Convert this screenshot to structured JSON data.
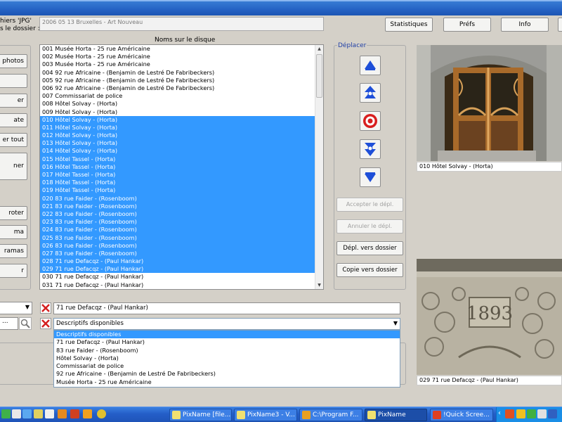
{
  "header": {
    "files_label_line1": "hiers 'JPG'",
    "files_label_line2": "s le dossier :",
    "folder_name": "2006 05 13 Bruxelles - Art Nouveau",
    "buttons": {
      "stats": "Statistiques",
      "prefs": "Préfs",
      "info": "Info"
    }
  },
  "left_buttons": [
    "photos",
    "",
    "er",
    "ate",
    "er tout",
    "ner",
    "roter",
    "ma",
    "ramas",
    "r"
  ],
  "file_list": {
    "title": "Noms sur le disque",
    "items": [
      "001  Musée Horta - 25 rue Américaine",
      "002  Musée Horta - 25 rue Américaine",
      "003  Musée Horta - 25 rue Américaine",
      "004  92 rue Africaine - (Benjamin de Lestré De Fabribeckers)",
      "005  92 rue Africaine - (Benjamin de Lestré De Fabribeckers)",
      "006  92 rue Africaine - (Benjamin de Lestré De Fabribeckers)",
      "007  Commissariat de police",
      "008  Hôtel Solvay - (Horta)",
      "009  Hôtel Solvay - (Horta)",
      "010  Hôtel Solvay - (Horta)",
      "011  Hôtel Solvay - (Horta)",
      "012  Hôtel Solvay - (Horta)",
      "013  Hôtel Solvay - (Horta)",
      "014  Hôtel Solvay - (Horta)",
      "015  Hôtel Tassel - (Horta)",
      "016  Hôtel Tassel - (Horta)",
      "017  Hôtel Tassel - (Horta)",
      "018  Hôtel Tassel - (Horta)",
      "019  Hôtel Tassel - (Horta)",
      "020  83 rue Faider - (Rosenboom)",
      "021  83 rue Faider - (Rosenboom)",
      "022  83 rue Faider - (Rosenboom)",
      "023  83 rue Faider - (Rosenboom)",
      "024  83 rue Faider - (Rosenboom)",
      "025  83 rue Faider - (Rosenboom)",
      "026  83 rue Faider - (Rosenboom)",
      "027  83 rue Faider - (Rosenboom)",
      "028  71 rue Defacqz - (Paul Hankar)",
      "029  71 rue Defacqz - (Paul Hankar)",
      "030  71 rue Defacqz - (Paul Hankar)",
      "031  71 rue Defacqz - (Paul Hankar)"
    ],
    "selected_from": 9,
    "selected_to": 28
  },
  "move_panel": {
    "title": "Déplacer",
    "accept": "Accepter le dépl.",
    "cancel": "Annuler le dépl.",
    "move_to_folder": "Dépl. vers dossier",
    "copy_to_folder": "Copie vers dossier"
  },
  "photos": {
    "top_caption": "010  Hôtel Solvay - (Horta)",
    "bottom_caption": "029  71 rue Defacqz - (Paul Hankar)",
    "stone_year": "1893"
  },
  "name_field": {
    "value": "71 rue Defacqz - (Paul Hankar)"
  },
  "descriptions": {
    "selected": "Descriptifs disponibles",
    "options": [
      "Descriptifs disponibles",
      "71 rue Defacqz - (Paul Hankar)",
      "83 rue Faider - (Rosenboom)",
      "Hôtel Solvay - (Horta)",
      "Commissariat de police",
      "92 rue Africaine - (Benjamin de Lestré De Fabribeckers)",
      "Musée Horta - 25 rue Américaine"
    ]
  },
  "search_field": {
    "value": "..."
  },
  "taskbar": {
    "tasks": [
      "PixName [file...",
      "PixName3 - V...",
      "C:\\Program F...",
      "PixName",
      "!Quick Scree..."
    ]
  },
  "colors": {
    "selection": "#3399ff",
    "arrow_blue": "#1e4fd8",
    "target_red": "#d81e1e"
  }
}
